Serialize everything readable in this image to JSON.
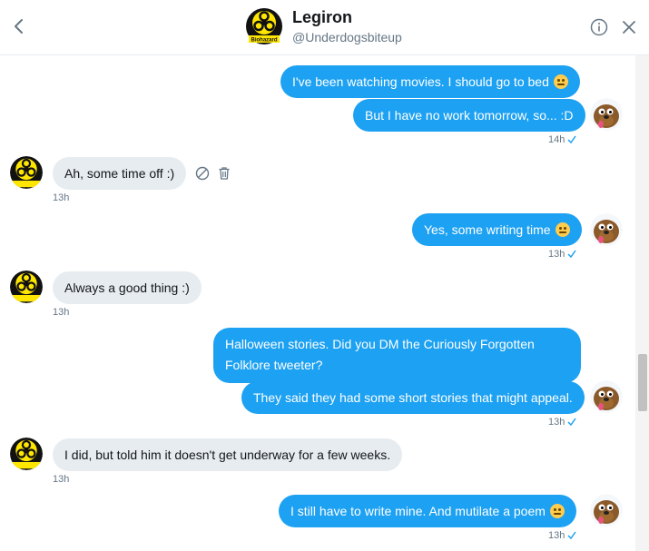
{
  "header": {
    "name": "Legiron",
    "handle": "@Underdogsbiteup",
    "avatar_label": "Biohazard"
  },
  "messages": [
    {
      "side": "sent",
      "text": "I've been watching movies. I should go to bed",
      "emoji": "grimacing-face"
    },
    {
      "side": "sent",
      "text": "But I have no work tomorrow, so... :D",
      "time": "14h"
    },
    {
      "side": "recv",
      "text": "Ah, some time off :)",
      "time": "13h"
    },
    {
      "side": "sent",
      "text": "Yes, some writing time",
      "emoji": "winking-face",
      "time": "13h"
    },
    {
      "side": "recv",
      "text": "Always a good thing :)",
      "time": "13h"
    },
    {
      "side": "sent",
      "text": "Halloween stories. Did you DM the Curiously Forgotten Folklore tweeter?"
    },
    {
      "side": "sent",
      "text": "They said they had some short stories that might appeal.",
      "time": "13h"
    },
    {
      "side": "recv",
      "text": "I did, but told him it doesn't get underway for a few weeks.",
      "time": "13h"
    },
    {
      "side": "sent",
      "text": "I still have to write mine. And mutilate a poem",
      "emoji": "winking-face",
      "time": "13h"
    }
  ],
  "colors": {
    "sent_bubble": "#1da1f2",
    "recv_bubble": "#e6ecf0",
    "check": "#1da1f2",
    "biohazard_bg": "#ffe600"
  },
  "icons": {
    "back": "chevron-left-icon",
    "info": "info-icon",
    "close": "close-icon",
    "block": "block-icon",
    "delete": "trash-icon",
    "read": "check-icon"
  }
}
